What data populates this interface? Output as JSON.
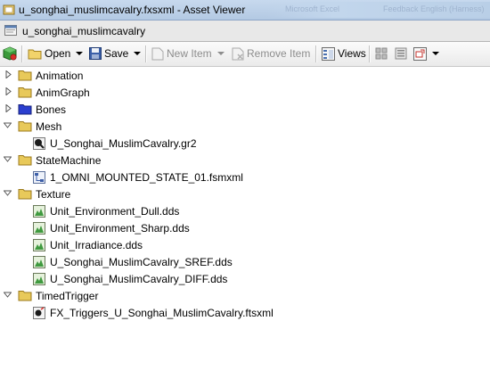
{
  "window": {
    "title": "u_songhai_muslimcavalry.fxsxml - Asset Viewer",
    "background_blurred_text": [
      "Microsoft Excel",
      "Feedback English (Harness)"
    ]
  },
  "tab": {
    "title": "u_songhai_muslimcavalry",
    "icon": "document-icon"
  },
  "toolbar": {
    "open_label": "Open",
    "save_label": "Save",
    "new_item_label": "New Item",
    "remove_item_label": "Remove Item",
    "views_label": "Views"
  },
  "tree": {
    "folders": [
      {
        "label": "Animation",
        "expanded": false,
        "color": "#e8c95a",
        "children": []
      },
      {
        "label": "AnimGraph",
        "expanded": false,
        "color": "#e8c95a",
        "children": []
      },
      {
        "label": "Bones",
        "expanded": false,
        "color": "#2b3fcf",
        "children": []
      },
      {
        "label": "Mesh",
        "expanded": true,
        "color": "#e8c95a",
        "children": [
          {
            "label": "U_Songhai_MuslimCavalry.gr2",
            "icon": "mesh-file-icon"
          }
        ]
      },
      {
        "label": "StateMachine",
        "expanded": true,
        "color": "#e8c95a",
        "children": [
          {
            "label": "1_OMNI_MOUNTED_STATE_01.fsmxml",
            "icon": "state-machine-file-icon"
          }
        ]
      },
      {
        "label": "Texture",
        "expanded": true,
        "color": "#e8c95a",
        "children": [
          {
            "label": "Unit_Environment_Dull.dds",
            "icon": "texture-file-icon"
          },
          {
            "label": "Unit_Environment_Sharp.dds",
            "icon": "texture-file-icon"
          },
          {
            "label": "Unit_Irradiance.dds",
            "icon": "texture-file-icon"
          },
          {
            "label": "U_Songhai_MuslimCavalry_SREF.dds",
            "icon": "texture-file-icon"
          },
          {
            "label": "U_Songhai_MuslimCavalry_DIFF.dds",
            "icon": "texture-file-icon"
          }
        ]
      },
      {
        "label": "TimedTrigger",
        "expanded": true,
        "color": "#e8c95a",
        "children": [
          {
            "label": "FX_Triggers_U_Songhai_MuslimCavalry.ftsxml",
            "icon": "trigger-file-icon"
          }
        ]
      }
    ]
  }
}
